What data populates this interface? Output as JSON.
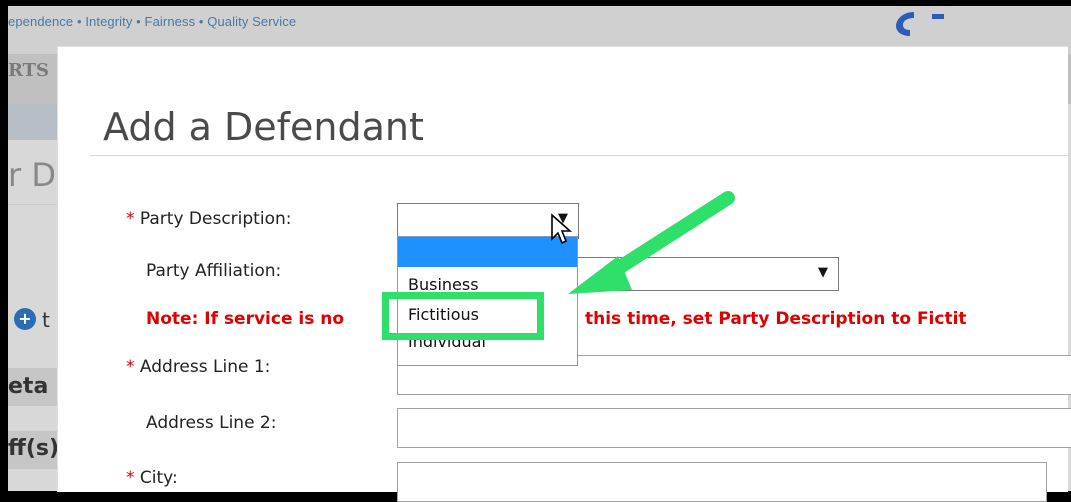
{
  "background": {
    "tagline": "ependence • Integrity • Fairness • Quality Service",
    "nav_tab": "RTS",
    "left_heading": "r D",
    "left_fragments": {
      "to": "t",
      "detail": "eta",
      "plaintiffs": "ff(s)"
    }
  },
  "modal": {
    "title": "Add a Defendant",
    "fields": {
      "party_description": {
        "label": "Party Description:",
        "required": true,
        "value": ""
      },
      "party_affiliation": {
        "label": "Party Affiliation:",
        "required": false,
        "value": ""
      },
      "address_line_1": {
        "label": "Address Line 1:",
        "required": true,
        "value": ""
      },
      "address_line_2": {
        "label": "Address Line 2:",
        "required": false,
        "value": ""
      },
      "city": {
        "label": "City:",
        "required": true,
        "value": ""
      }
    },
    "note_left": "Note: If service is no",
    "note_right": "this time, set Party Description to Fictit"
  },
  "dropdown": {
    "options": [
      "",
      "Business",
      "Fictitious",
      "Individual"
    ],
    "hovered": ""
  },
  "annotation": {
    "highlight_color": "#2ee06a",
    "target_option": "Fictitious"
  },
  "colors": {
    "required_star": "#dd0000",
    "note": "#e00000",
    "dropdown_highlight": "#1e90ff"
  }
}
